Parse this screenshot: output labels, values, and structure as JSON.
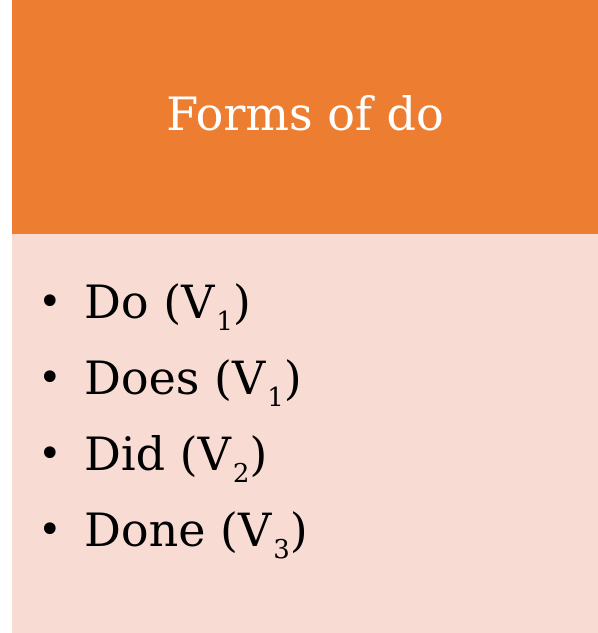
{
  "slide": {
    "title": "Forms of do",
    "colors": {
      "header_bg": "#ed7d31",
      "body_bg": "#f8dcd4",
      "title_text": "#ffffff",
      "body_text": "#000000"
    },
    "items": [
      {
        "bullet": "•",
        "word": "Do",
        "open": " (V",
        "sub": "1",
        "close": ")"
      },
      {
        "bullet": "•",
        "word": "Does",
        "open": " (V",
        "sub": "1",
        "close": ")"
      },
      {
        "bullet": "•",
        "word": "Did",
        "open": " (V",
        "sub": "2",
        "close": ")"
      },
      {
        "bullet": "•",
        "word": "Done",
        "open": " (V",
        "sub": "3",
        "close": ")"
      }
    ]
  }
}
